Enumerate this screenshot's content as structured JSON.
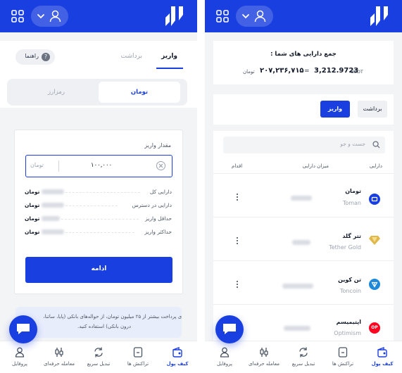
{
  "common": {
    "tabs": [
      {
        "label": "کیف پول",
        "icon": "wallet-icon",
        "active": true
      },
      {
        "label": "تراکنش ها",
        "icon": "transactions-icon",
        "active": false
      },
      {
        "label": "تبدیل سریع",
        "icon": "swap-icon",
        "active": false
      },
      {
        "label": "معامله حرفه‌ای",
        "icon": "candlestick-icon",
        "active": false
      },
      {
        "label": "پروفایل",
        "icon": "profile-icon",
        "active": false
      }
    ],
    "colors": {
      "primary": "#1a3fe0",
      "background": "#f3f4f6",
      "card": "#ffffff"
    }
  },
  "deposit": {
    "tabs": {
      "deposit": "واریز",
      "withdraw": "برداشت"
    },
    "guide_label": "راهنما",
    "currency_toggle": {
      "toman": "تومان",
      "crypto": "رمزارز"
    },
    "amount_label": "مقدار واریز",
    "amount_value": "۱۰۰,۰۰۰",
    "amount_unit": "تومان",
    "info_rows": [
      {
        "label": "دارایی کل",
        "unit": "تومان"
      },
      {
        "label": "دارایی در دسترس",
        "unit": "تومان"
      },
      {
        "label": "حداقل واریز",
        "unit": "تومان"
      },
      {
        "label": "حداکثر واریز",
        "unit": "تومان"
      }
    ],
    "continue_button": "ادامه",
    "notice_line1": "برای پرداخت بیشتر از ۲۵ میلیون تومان، از حواله‌های بانکی (پایا، ساتنا،",
    "notice_line2": "درون بانکی) استفاده کنید."
  },
  "wallet": {
    "total_title": "جمع دارایی های شما :",
    "total_toman": "۲۰۷,۲۳۶,۷۱۵",
    "toman_unit": "تومان",
    "equals": "=",
    "total_usdt": "3,212.9723",
    "usdt_unit": "USDT",
    "deposit_button": "واریز",
    "withdraw_button": "برداشت",
    "search_placeholder": "جست و جو",
    "columns": {
      "asset": "دارایی",
      "amount": "میزان دارایی",
      "action": "اقدام"
    },
    "assets": [
      {
        "name_fa": "تومان",
        "name_en": "Toman",
        "icon": "toman-icon",
        "color": "#1a3fe0"
      },
      {
        "name_fa": "تتر گلد",
        "name_en": "Tether Gold",
        "icon": "tether-gold-icon",
        "color": "#e0b84a"
      },
      {
        "name_fa": "تن کوین",
        "name_en": "Toncoin",
        "icon": "toncoin-icon",
        "color": "#1e88d9"
      },
      {
        "name_fa": "اپتیمیسم",
        "name_en": "Optimism",
        "icon": "optimism-icon",
        "color": "#ff0420"
      }
    ]
  }
}
